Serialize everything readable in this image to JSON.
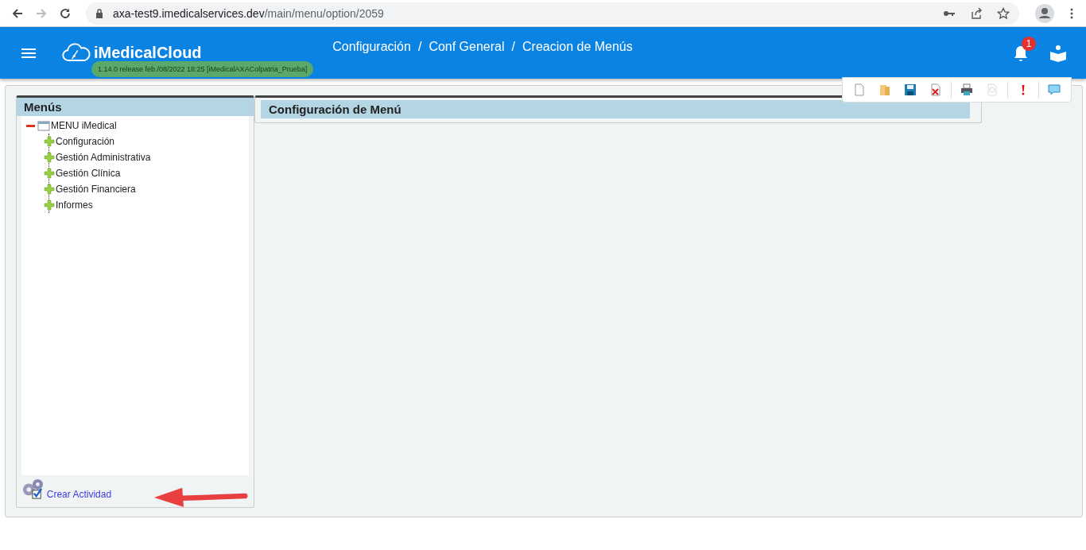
{
  "browser": {
    "url_host": "axa-test9.imedicalservices.dev",
    "url_path": "/main/menu/option/2059"
  },
  "header": {
    "app_name": "iMedicalCloud",
    "version": "1.14.0 release feb./08/2022 18:25 [iMedicalAXAColpatria_Prueba]",
    "breadcrumb": [
      "Configuración",
      "Conf General",
      "Creacion de Menús"
    ],
    "breadcrumb_separator": "/",
    "notification_count": "1"
  },
  "toolbar": [
    {
      "kind": "new"
    },
    {
      "kind": "open"
    },
    {
      "kind": "save"
    },
    {
      "kind": "delete"
    },
    {
      "kind": "sep"
    },
    {
      "kind": "print"
    },
    {
      "kind": "preview",
      "disabled": true
    },
    {
      "kind": "sep"
    },
    {
      "kind": "alert"
    },
    {
      "kind": "sep"
    },
    {
      "kind": "comment"
    }
  ],
  "menu_panel": {
    "title": "Menús",
    "tree": [
      {
        "label": "MENU iMedical",
        "expanded": true,
        "children": [
          {
            "label": "Configuración",
            "expanded": false
          },
          {
            "label": "Gestión Administrativa",
            "expanded": false
          },
          {
            "label": "Gestión Clínica",
            "expanded": false
          },
          {
            "label": "Gestión Financiera",
            "expanded": false
          },
          {
            "label": "Informes",
            "expanded": false
          }
        ]
      }
    ],
    "action_link": "Crear Actividad"
  },
  "config_panel": {
    "title": "Configuración de Menú"
  }
}
